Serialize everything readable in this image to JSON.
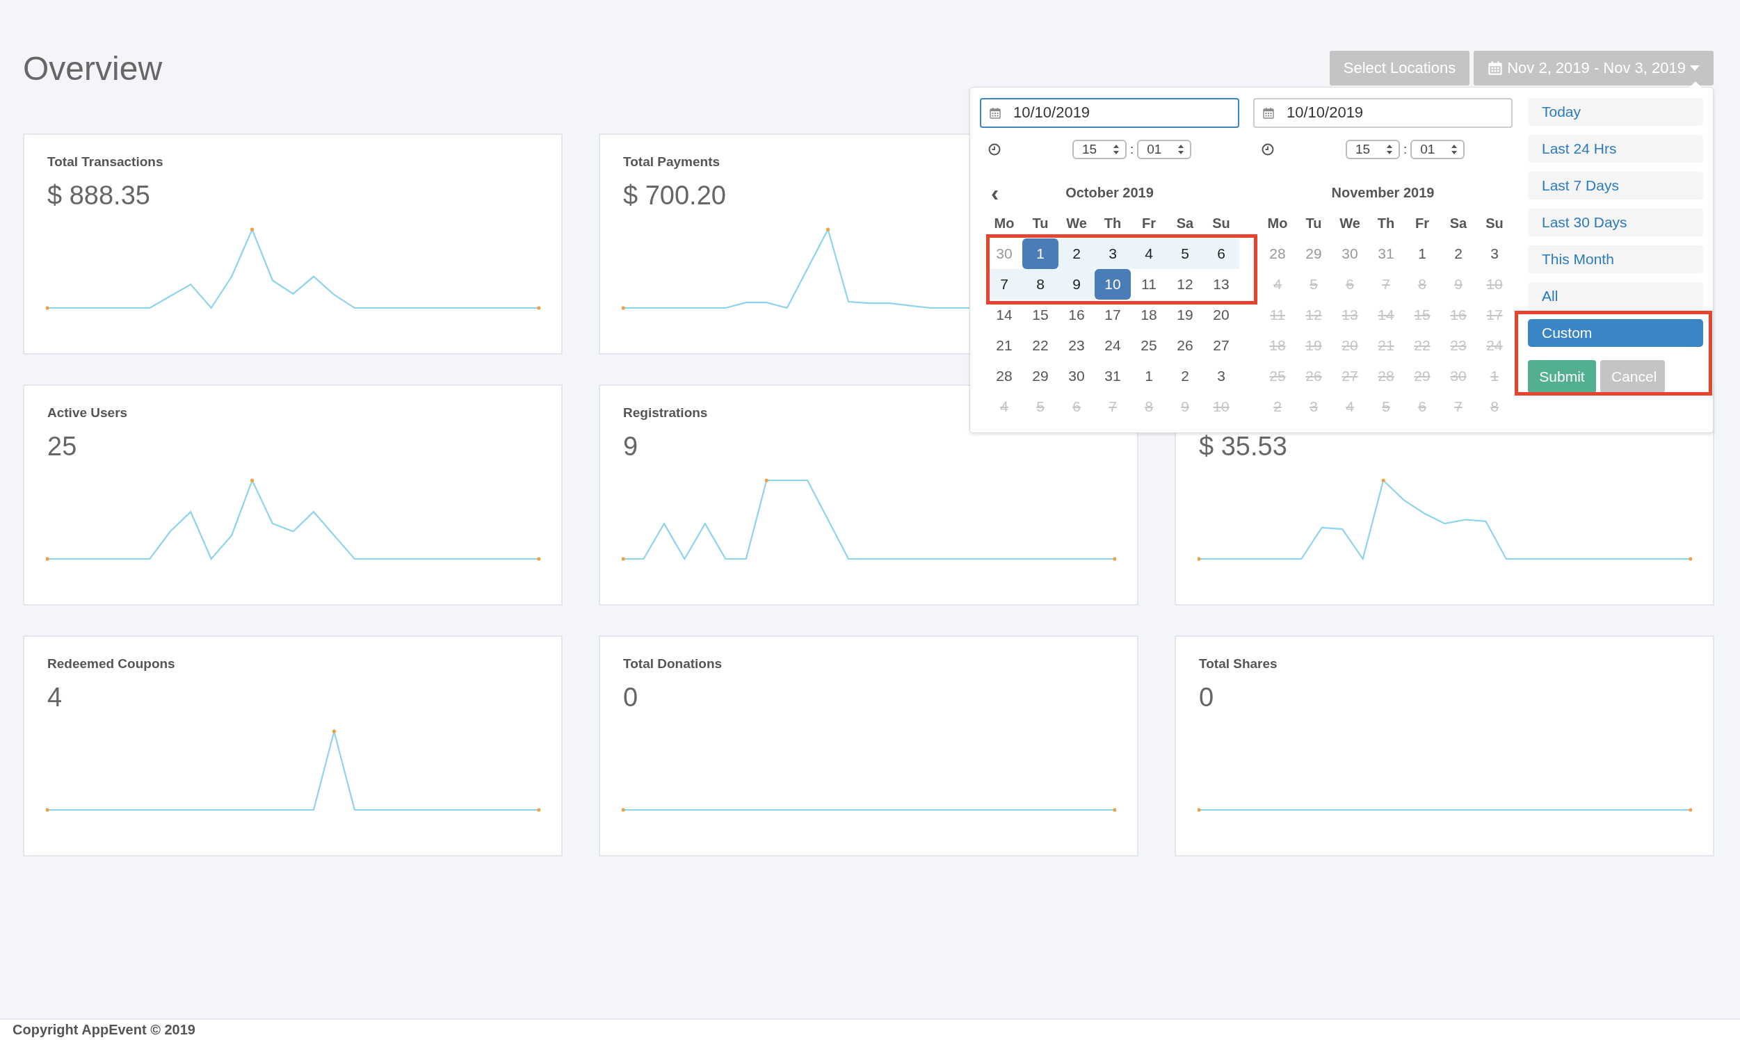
{
  "page_title": "Overview",
  "header_buttons": [
    {
      "kind": "plain",
      "label": "Select Locations"
    },
    {
      "kind": "date",
      "label": "Nov 2, 2019 - Nov 3, 2019"
    }
  ],
  "cards": [
    {
      "title": "Total Transactions",
      "value": "$ 888.35"
    },
    {
      "title": "Total Payments",
      "value": "$ 700.20"
    },
    {
      "title": "Active Users",
      "value": "25"
    },
    {
      "title": "Registrations",
      "value": "9"
    },
    {
      "value": "$ 35.53"
    },
    {
      "title": "Redeemed Coupons",
      "value": "4"
    },
    {
      "title": "Total Donations",
      "value": "0"
    },
    {
      "title": "Total Shares",
      "value": "0"
    }
  ],
  "date_picker": {
    "calendars": [
      {
        "date_value": "10/10/2019",
        "focused": true,
        "hour": "15",
        "minute": "01",
        "separator": ":",
        "prev_arrow": "‹",
        "month": "October 2019",
        "weekdays": [
          "Mo",
          "Tu",
          "We",
          "Th",
          "Fr",
          "Sa",
          "Su"
        ],
        "weeks": [
          [
            {
              "label": "30",
              "kind": "off",
              "selected": false,
              "in_range": false
            },
            {
              "label": "1",
              "kind": "normal",
              "selected": true,
              "in_range": true
            },
            {
              "label": "2",
              "kind": "normal",
              "selected": false,
              "in_range": true
            },
            {
              "label": "3",
              "kind": "normal",
              "selected": false,
              "in_range": true
            },
            {
              "label": "4",
              "kind": "normal",
              "selected": false,
              "in_range": true
            },
            {
              "label": "5",
              "kind": "normal",
              "selected": false,
              "in_range": true
            },
            {
              "label": "6",
              "kind": "normal",
              "selected": false,
              "in_range": true
            }
          ],
          [
            {
              "label": "7",
              "kind": "normal",
              "selected": false,
              "in_range": true
            },
            {
              "label": "8",
              "kind": "normal",
              "selected": false,
              "in_range": true
            },
            {
              "label": "9",
              "kind": "normal",
              "selected": false,
              "in_range": true
            },
            {
              "label": "10",
              "kind": "normal",
              "selected": true,
              "in_range": true
            },
            {
              "label": "11",
              "kind": "normal",
              "selected": false,
              "in_range": false
            },
            {
              "label": "12",
              "kind": "normal",
              "selected": false,
              "in_range": false
            },
            {
              "label": "13",
              "kind": "normal",
              "selected": false,
              "in_range": false
            }
          ],
          [
            {
              "label": "14",
              "kind": "normal",
              "selected": false,
              "in_range": false
            },
            {
              "label": "15",
              "kind": "normal",
              "selected": false,
              "in_range": false
            },
            {
              "label": "16",
              "kind": "normal",
              "selected": false,
              "in_range": false
            },
            {
              "label": "17",
              "kind": "normal",
              "selected": false,
              "in_range": false
            },
            {
              "label": "18",
              "kind": "normal",
              "selected": false,
              "in_range": false
            },
            {
              "label": "19",
              "kind": "normal",
              "selected": false,
              "in_range": false
            },
            {
              "label": "20",
              "kind": "normal",
              "selected": false,
              "in_range": false
            }
          ],
          [
            {
              "label": "21",
              "kind": "normal",
              "selected": false,
              "in_range": false
            },
            {
              "label": "22",
              "kind": "normal",
              "selected": false,
              "in_range": false
            },
            {
              "label": "23",
              "kind": "normal",
              "selected": false,
              "in_range": false
            },
            {
              "label": "24",
              "kind": "normal",
              "selected": false,
              "in_range": false
            },
            {
              "label": "25",
              "kind": "normal",
              "selected": false,
              "in_range": false
            },
            {
              "label": "26",
              "kind": "normal",
              "selected": false,
              "in_range": false
            },
            {
              "label": "27",
              "kind": "normal",
              "selected": false,
              "in_range": false
            }
          ],
          [
            {
              "label": "28",
              "kind": "normal",
              "selected": false,
              "in_range": false
            },
            {
              "label": "29",
              "kind": "normal",
              "selected": false,
              "in_range": false
            },
            {
              "label": "30",
              "kind": "normal",
              "selected": false,
              "in_range": false
            },
            {
              "label": "31",
              "kind": "normal",
              "selected": false,
              "in_range": false
            },
            {
              "label": "1",
              "kind": "normal",
              "selected": false,
              "in_range": false
            },
            {
              "label": "2",
              "kind": "normal",
              "selected": false,
              "in_range": false
            },
            {
              "label": "3",
              "kind": "normal",
              "selected": false,
              "in_range": false
            }
          ],
          [
            {
              "label": "4",
              "kind": "disabled",
              "selected": false,
              "in_range": false
            },
            {
              "label": "5",
              "kind": "disabled",
              "selected": false,
              "in_range": false
            },
            {
              "label": "6",
              "kind": "disabled",
              "selected": false,
              "in_range": false
            },
            {
              "label": "7",
              "kind": "disabled",
              "selected": false,
              "in_range": false
            },
            {
              "label": "8",
              "kind": "disabled",
              "selected": false,
              "in_range": false
            },
            {
              "label": "9",
              "kind": "disabled",
              "selected": false,
              "in_range": false
            },
            {
              "label": "10",
              "kind": "disabled",
              "selected": false,
              "in_range": false
            }
          ]
        ]
      },
      {
        "date_value": "10/10/2019",
        "focused": false,
        "hour": "15",
        "minute": "01",
        "separator": ":",
        "month": "November 2019",
        "weekdays": [
          "Mo",
          "Tu",
          "We",
          "Th",
          "Fr",
          "Sa",
          "Su"
        ],
        "weeks": [
          [
            {
              "label": "28",
              "kind": "off",
              "selected": false,
              "in_range": false
            },
            {
              "label": "29",
              "kind": "off",
              "selected": false,
              "in_range": false
            },
            {
              "label": "30",
              "kind": "off",
              "selected": false,
              "in_range": false
            },
            {
              "label": "31",
              "kind": "off",
              "selected": false,
              "in_range": false
            },
            {
              "label": "1",
              "kind": "normal",
              "selected": false,
              "in_range": false
            },
            {
              "label": "2",
              "kind": "normal",
              "selected": false,
              "in_range": false
            },
            {
              "label": "3",
              "kind": "normal",
              "selected": false,
              "in_range": false
            }
          ],
          [
            {
              "label": "4",
              "kind": "disabled",
              "selected": false,
              "in_range": false
            },
            {
              "label": "5",
              "kind": "disabled",
              "selected": false,
              "in_range": false
            },
            {
              "label": "6",
              "kind": "disabled",
              "selected": false,
              "in_range": false
            },
            {
              "label": "7",
              "kind": "disabled",
              "selected": false,
              "in_range": false
            },
            {
              "label": "8",
              "kind": "disabled",
              "selected": false,
              "in_range": false
            },
            {
              "label": "9",
              "kind": "disabled",
              "selected": false,
              "in_range": false
            },
            {
              "label": "10",
              "kind": "disabled",
              "selected": false,
              "in_range": false
            }
          ],
          [
            {
              "label": "11",
              "kind": "disabled",
              "selected": false,
              "in_range": false
            },
            {
              "label": "12",
              "kind": "disabled",
              "selected": false,
              "in_range": false
            },
            {
              "label": "13",
              "kind": "disabled",
              "selected": false,
              "in_range": false
            },
            {
              "label": "14",
              "kind": "disabled",
              "selected": false,
              "in_range": false
            },
            {
              "label": "15",
              "kind": "disabled",
              "selected": false,
              "in_range": false
            },
            {
              "label": "16",
              "kind": "disabled",
              "selected": false,
              "in_range": false
            },
            {
              "label": "17",
              "kind": "disabled",
              "selected": false,
              "in_range": false
            }
          ],
          [
            {
              "label": "18",
              "kind": "disabled",
              "selected": false,
              "in_range": false
            },
            {
              "label": "19",
              "kind": "disabled",
              "selected": false,
              "in_range": false
            },
            {
              "label": "20",
              "kind": "disabled",
              "selected": false,
              "in_range": false
            },
            {
              "label": "21",
              "kind": "disabled",
              "selected": false,
              "in_range": false
            },
            {
              "label": "22",
              "kind": "disabled",
              "selected": false,
              "in_range": false
            },
            {
              "label": "23",
              "kind": "disabled",
              "selected": false,
              "in_range": false
            },
            {
              "label": "24",
              "kind": "disabled",
              "selected": false,
              "in_range": false
            }
          ],
          [
            {
              "label": "25",
              "kind": "disabled",
              "selected": false,
              "in_range": false
            },
            {
              "label": "26",
              "kind": "disabled",
              "selected": false,
              "in_range": false
            },
            {
              "label": "27",
              "kind": "disabled",
              "selected": false,
              "in_range": false
            },
            {
              "label": "28",
              "kind": "disabled",
              "selected": false,
              "in_range": false
            },
            {
              "label": "29",
              "kind": "disabled",
              "selected": false,
              "in_range": false
            },
            {
              "label": "30",
              "kind": "disabled",
              "selected": false,
              "in_range": false
            },
            {
              "label": "1",
              "kind": "disabled",
              "selected": false,
              "in_range": false
            }
          ],
          [
            {
              "label": "2",
              "kind": "disabled",
              "selected": false,
              "in_range": false
            },
            {
              "label": "3",
              "kind": "disabled",
              "selected": false,
              "in_range": false
            },
            {
              "label": "4",
              "kind": "disabled",
              "selected": false,
              "in_range": false
            },
            {
              "label": "5",
              "kind": "disabled",
              "selected": false,
              "in_range": false
            },
            {
              "label": "6",
              "kind": "disabled",
              "selected": false,
              "in_range": false
            },
            {
              "label": "7",
              "kind": "disabled",
              "selected": false,
              "in_range": false
            },
            {
              "label": "8",
              "kind": "disabled",
              "selected": false,
              "in_range": false
            }
          ]
        ]
      }
    ],
    "ranges": [
      {
        "label": "Today",
        "selected": false
      },
      {
        "label": "Last 24 Hrs",
        "selected": false
      },
      {
        "label": "Last 7 Days",
        "selected": false
      },
      {
        "label": "Last 30 Days",
        "selected": false
      },
      {
        "label": "This Month",
        "selected": false
      },
      {
        "label": "All",
        "selected": false
      },
      {
        "label": "Custom",
        "selected": true
      }
    ],
    "actions": [
      {
        "kind": "submit",
        "label": "Submit"
      },
      {
        "kind": "cancel",
        "label": "Cancel"
      }
    ]
  },
  "footer": "Copyright AppEvent © 2019"
}
